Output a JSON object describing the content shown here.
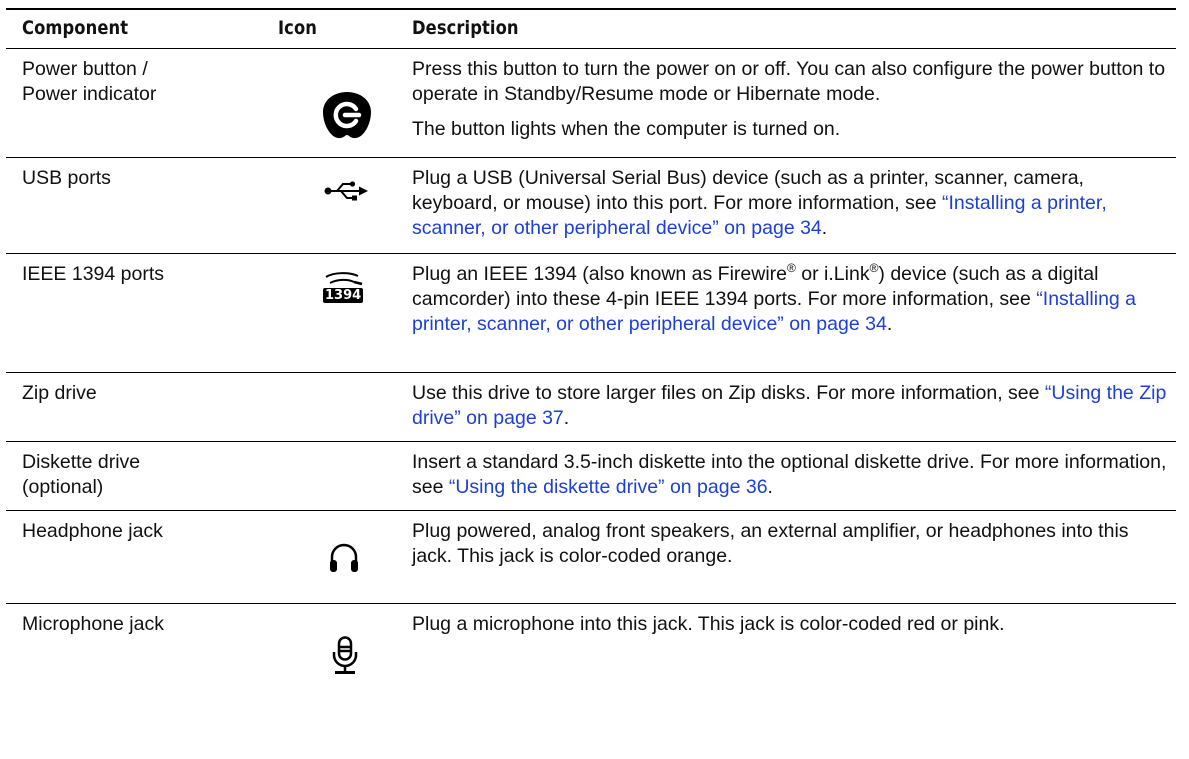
{
  "table": {
    "headers": {
      "component": "Component",
      "icon": "Icon",
      "description": "Description"
    },
    "rows": [
      {
        "component": [
          "Power button /",
          "Power indicator"
        ],
        "icon": "power-icon",
        "p1": "Press this button to turn the power on or off. You can also configure the power button to operate in Standby/Resume mode or Hibernate mode.",
        "p2": "The button lights when the computer is turned on."
      },
      {
        "component": [
          "USB ports"
        ],
        "icon": "usb-icon",
        "pre": "Plug a USB (Universal Serial Bus) device (such as a printer, scanner, camera, keyboard, or mouse) into this port. For more information, see ",
        "link": "“Installing a printer, scanner, or other peripheral device” on page 34",
        "post": "."
      },
      {
        "component": [
          "IEEE 1394 ports"
        ],
        "icon": "firewire-1394-icon",
        "icon_label": "1394",
        "a": "Plug an IEEE 1394 (also known as Firewire",
        "reg1": "®",
        "b": " or i.Link",
        "reg2": "®",
        "c": ") device (such as a digital camcorder) into these 4-pin IEEE 1394 ports. For more information, see ",
        "link": "“Installing a printer, scanner, or other peripheral device” on page 34",
        "post": "."
      },
      {
        "component": [
          "Zip drive"
        ],
        "pre": "Use this drive to store larger files on Zip disks. For more information, see ",
        "link": "“Using the Zip drive” on page 37",
        "post": "."
      },
      {
        "component": [
          "Diskette drive",
          "(optional)"
        ],
        "pre": "Insert a standard 3.5-inch diskette into the optional diskette drive. For more information, see ",
        "link": "“Using the diskette drive” on page 36",
        "post": "."
      },
      {
        "component": [
          "Headphone jack"
        ],
        "icon": "headphone-icon",
        "text": "Plug powered, analog front speakers, an external amplifier, or headphones into this jack. This jack is color-coded orange."
      },
      {
        "component": [
          "Microphone jack"
        ],
        "icon": "microphone-icon",
        "text": "Plug a microphone into this jack. This jack is color-coded red or pink."
      }
    ]
  },
  "colors": {
    "link": "#1d3fd6",
    "rule": "#000000",
    "text": "#111111"
  }
}
